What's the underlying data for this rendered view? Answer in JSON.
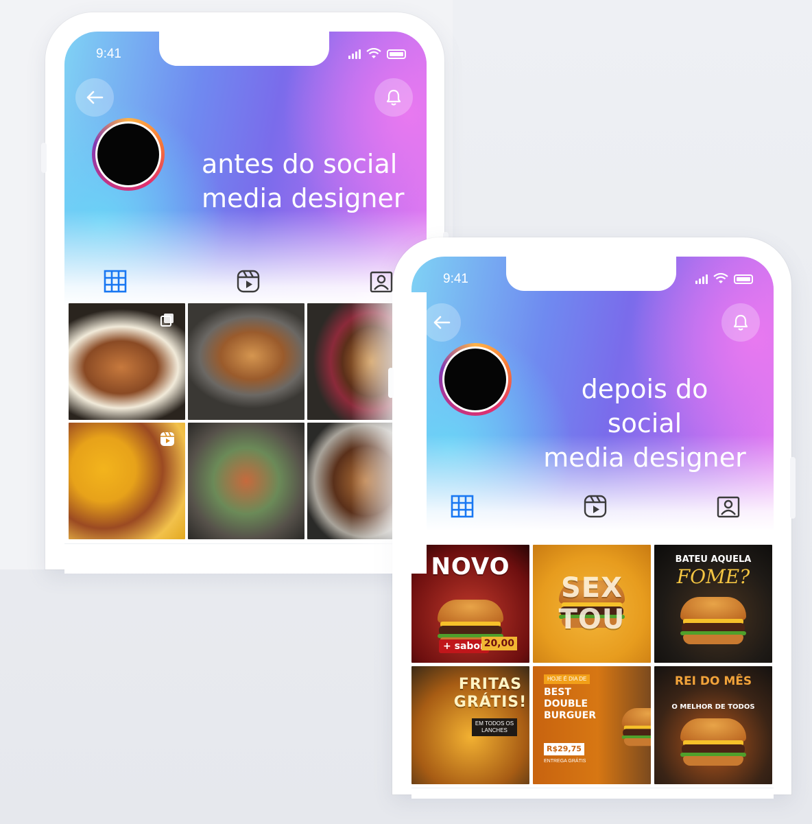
{
  "before": {
    "status_time": "9:41",
    "headline_line1": "antes do social",
    "headline_line2": "media designer"
  },
  "after": {
    "status_time": "9:41",
    "headline_line1": "depois do social",
    "headline_line2": "media designer",
    "posts": [
      {
        "title": "NOVO",
        "subtitle": "+ sabor",
        "price": "20,00"
      },
      {
        "title": "SEX TOU",
        "subtitle": ""
      },
      {
        "title": "BATEU AQUELA",
        "subtitle": "FOME?"
      },
      {
        "title": "FRITAS GRÁTIS!",
        "subtitle": "EM TODOS OS LANCHES"
      },
      {
        "title": "BEST DOUBLE BURGUER",
        "subtitle": "HOJE É DIA DE",
        "price": "R$29,75",
        "note": "ENTREGA GRÁTIS"
      },
      {
        "title": "REI DO MÊS",
        "subtitle": "O MELHOR DE TODOS"
      }
    ]
  },
  "icons": {
    "back": "arrow-left-icon",
    "bell": "bell-icon",
    "grid": "grid-icon",
    "reels": "reels-icon",
    "tagged": "tagged-icon"
  },
  "colors": {
    "gradient_start": "#7fd2f4",
    "gradient_mid": "#7a6ceb",
    "gradient_end": "#e37af2",
    "tab_active": "#1877f2"
  }
}
